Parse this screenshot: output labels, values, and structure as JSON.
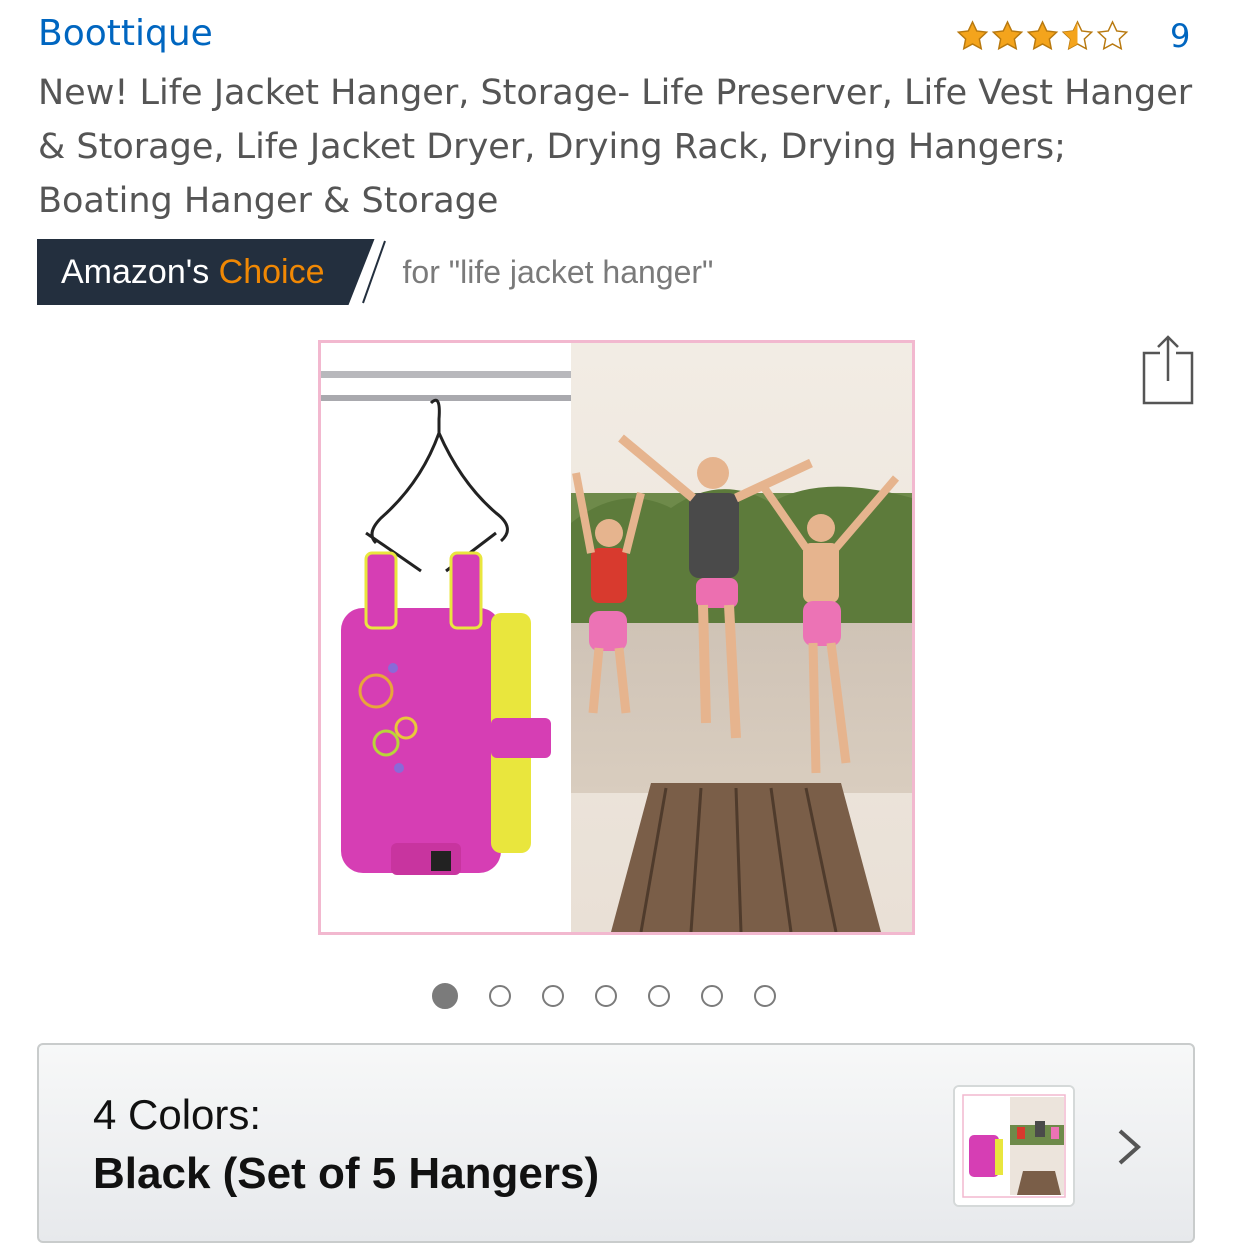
{
  "header": {
    "brand": "Boottique",
    "rating_value": 3.5,
    "rating_max": 5,
    "rating_count": "9",
    "star_color": "#f4a41c"
  },
  "product": {
    "title": "New! Life Jacket Hanger, Storage- Life Preserver, Life Vest Hanger & Storage, Life Jacket Dryer, Drying Rack, Drying Hangers; Boating Hanger & Storage"
  },
  "badge": {
    "amazons": "Amazon's ",
    "choice": "Choice",
    "for_text": "for \"life jacket hanger\"",
    "bg_color": "#232f3e",
    "accent_color": "#f08804"
  },
  "gallery": {
    "image_count": 7,
    "active_index": 0
  },
  "variation": {
    "label": "4 Colors:",
    "selected": "Black (Set of 5 Hangers)"
  },
  "icons": {
    "share": "share-icon",
    "next": "chevron-right-icon",
    "star": "star-icon"
  }
}
